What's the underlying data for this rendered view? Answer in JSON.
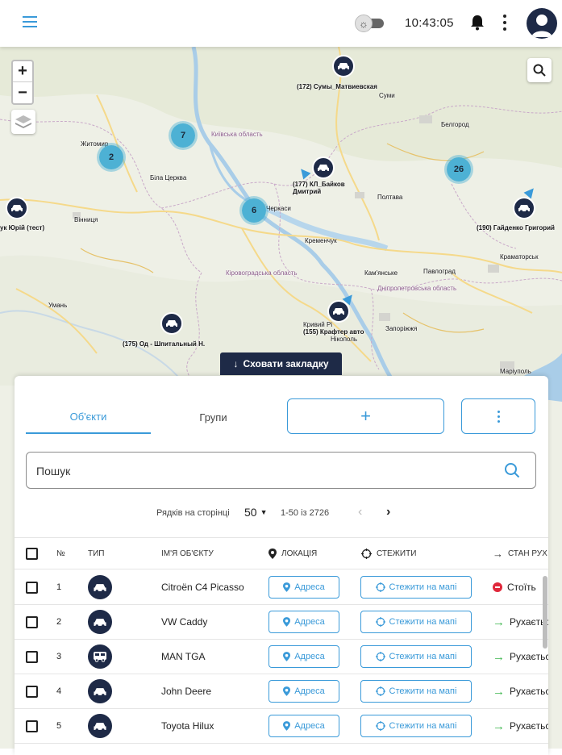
{
  "header": {
    "clock": "10:43:05"
  },
  "map": {
    "clusters": [
      "2",
      "7",
      "6",
      "26"
    ],
    "markers": {
      "sumy": "(172) Сумы_Матвиевская",
      "kl": "(177) КЛ_Байков Дмитрий",
      "yurii": "ук Юрій (тест)",
      "haidenko": "(190) Гайденко Григорий",
      "krafter": "(155) Крафтер авто",
      "od": "(175) Од - Шпитальный Н."
    },
    "places": {
      "belgorod": "Белгород",
      "poltava": "Полтава",
      "kryvyi": "Кривий Рі",
      "zaporizhzhia": "Запоріжжя",
      "kramatorsk": "Краматорськ",
      "mariupol": "Маріуполь",
      "pavlohrad": "Павлоград",
      "vinnytsia": "Вінниця",
      "bila": "Біла Церква",
      "zhytomyr": "Житомир",
      "sumy_city": "Суми",
      "kyiv_obl": "Київська область",
      "cherkasy": "Черкаси",
      "kremenchuk": "Кременчук",
      "kropyvnytskyi": "Кіровоградська область",
      "dnipro_obl": "Дніпропетровська область",
      "nikopol": "Нікополь",
      "uman": "Умань",
      "kamianske": "Кам'янське"
    },
    "hide_tab": "Сховати закладку"
  },
  "panel": {
    "tabs": {
      "objects": "Об'єкти",
      "groups": "Групи"
    },
    "add_label": "+",
    "search_placeholder": "Пошук",
    "pager": {
      "rows_label": "Рядків на сторінці",
      "rows_value": "50",
      "range": "1-50 із 2726"
    },
    "columns": {
      "num": "№",
      "type": "ТИП",
      "name": "ІМ'Я ОБ'ЄКТУ",
      "location": "ЛОКАЦІЯ",
      "track": "СТЕЖИТИ",
      "status": "СТАН РУХ"
    },
    "address_label": "Адреса",
    "track_label": "Стежити на мапі",
    "rows": [
      {
        "num": "1",
        "name": "Citroën C4 Picasso",
        "icon": "car-icon",
        "status": "Стоїть",
        "status_kind": "stopped"
      },
      {
        "num": "2",
        "name": "VW Caddy",
        "icon": "car-icon",
        "status": "Рухається",
        "status_kind": "moving"
      },
      {
        "num": "3",
        "name": "MAN TGA",
        "icon": "bus-icon",
        "status": "Рухається",
        "status_kind": "moving"
      },
      {
        "num": "4",
        "name": "John Deere",
        "icon": "car-icon",
        "status": "Рухається",
        "status_kind": "moving"
      },
      {
        "num": "5",
        "name": "Toyota Hilux",
        "icon": "car-icon",
        "status": "Рухається",
        "status_kind": "moving"
      }
    ]
  },
  "colors": {
    "accent": "#3a9ad9",
    "navy": "#1e2a47",
    "cluster": "#4db1d4",
    "stopped": "#e0283b",
    "moving": "#3ab54a"
  }
}
